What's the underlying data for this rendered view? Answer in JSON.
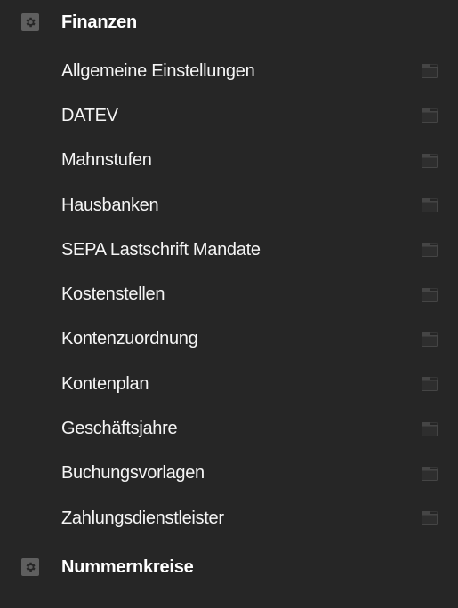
{
  "sections": {
    "finance": {
      "title": "Finanzen",
      "icon": "gear-icon"
    },
    "number_ranges": {
      "title": "Nummernkreise",
      "icon": "gear-icon"
    }
  },
  "menu": {
    "item_icon": "open-window-icon",
    "items": [
      {
        "label": "Allgemeine Einstellungen"
      },
      {
        "label": "DATEV"
      },
      {
        "label": "Mahnstufen"
      },
      {
        "label": "Hausbanken"
      },
      {
        "label": "SEPA Lastschrift Mandate"
      },
      {
        "label": "Kostenstellen"
      },
      {
        "label": "Kontenzuordnung"
      },
      {
        "label": "Kontenplan"
      },
      {
        "label": "Geschäftsjahre"
      },
      {
        "label": "Buchungsvorlagen"
      },
      {
        "label": "Zahlungsdienstleister"
      }
    ]
  },
  "colors": {
    "background": "#262626",
    "icon_box": "#5f5f5f",
    "text": "#f5f5f5"
  }
}
